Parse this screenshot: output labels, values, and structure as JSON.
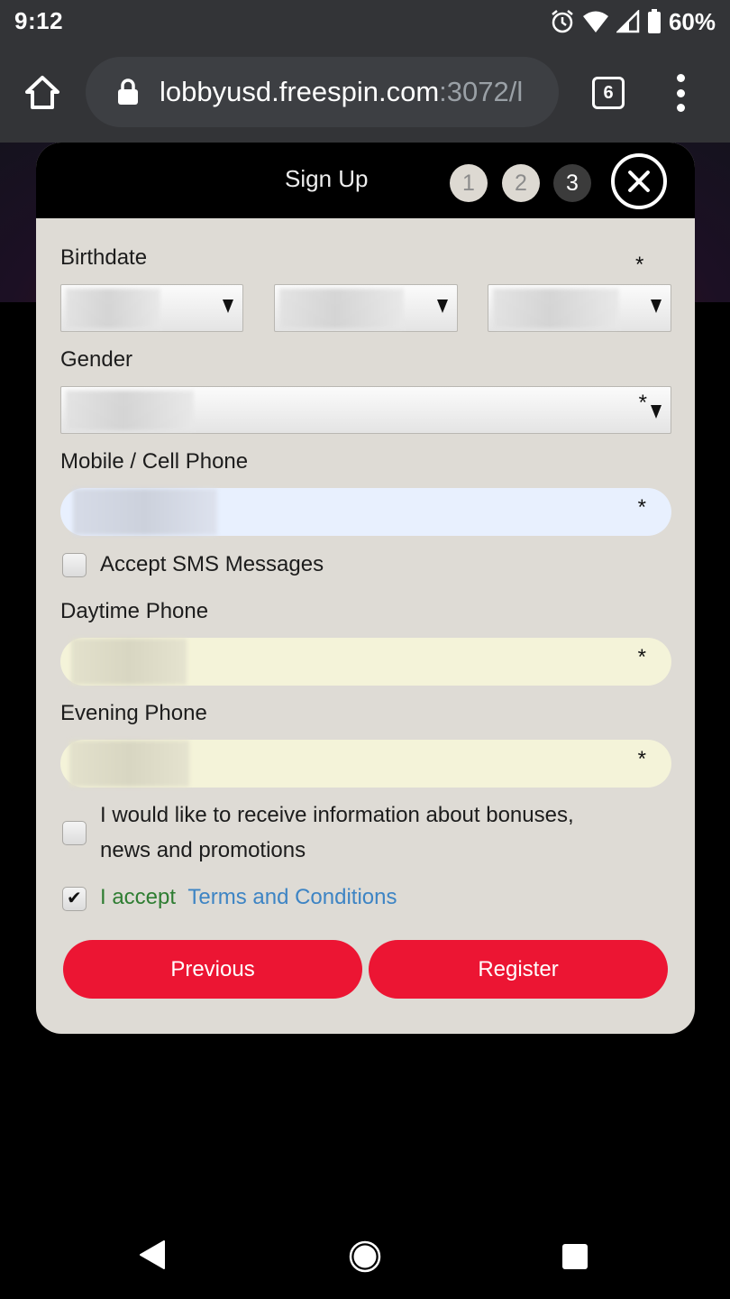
{
  "status_bar": {
    "time": "9:12",
    "battery_percent": "60%",
    "icons": [
      "alarm-icon",
      "wifi-icon",
      "cell-signal-icon",
      "battery-icon"
    ]
  },
  "browser": {
    "url_host": "lobbyusd.freespin.com",
    "url_rest": ":3072/l",
    "tab_count": "6"
  },
  "modal": {
    "title": "Sign Up",
    "steps": [
      "1",
      "2",
      "3"
    ],
    "active_step": 3,
    "fields": {
      "birthdate_label": "Birthdate",
      "gender_label": "Gender",
      "mobile_label": "Mobile / Cell Phone",
      "daytime_label": "Daytime Phone",
      "evening_label": "Evening Phone",
      "required_mark": "*"
    },
    "checkboxes": {
      "sms_label": "Accept SMS Messages",
      "sms_checked": false,
      "promo_label_line1": "I would like to receive information about bonuses,",
      "promo_label_line2": "news and promotions",
      "promo_checked": false,
      "accept_label": "I accept",
      "terms_link": "Terms and Conditions",
      "accept_checked": true
    },
    "buttons": {
      "previous": "Previous",
      "register": "Register"
    },
    "colors": {
      "button": "#ec1533",
      "accept_text": "#2e7d32",
      "terms_link": "#3d84c4",
      "autofill_blue": "#e8f0fe",
      "autofill_yellow": "#f4f3d9"
    }
  }
}
